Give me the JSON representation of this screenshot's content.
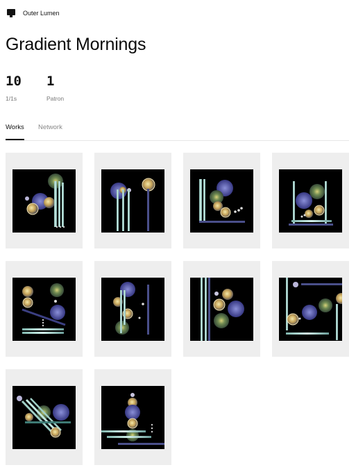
{
  "header": {
    "brand": "Outer Lumen",
    "logo_icon": "monitor-icon"
  },
  "collection": {
    "title": "Gradient Mornings"
  },
  "stats": [
    {
      "value": "10",
      "label": "1/1s"
    },
    {
      "value": "1",
      "label": "Patron"
    }
  ],
  "tabs": [
    {
      "label": "Works",
      "active": true
    },
    {
      "label": "Network",
      "active": false
    }
  ],
  "works_count": 10,
  "colors": {
    "background": "#ffffff",
    "card": "#eeeeee",
    "artwork_bg": "#000000",
    "text": "#111111",
    "muted": "#888888"
  }
}
